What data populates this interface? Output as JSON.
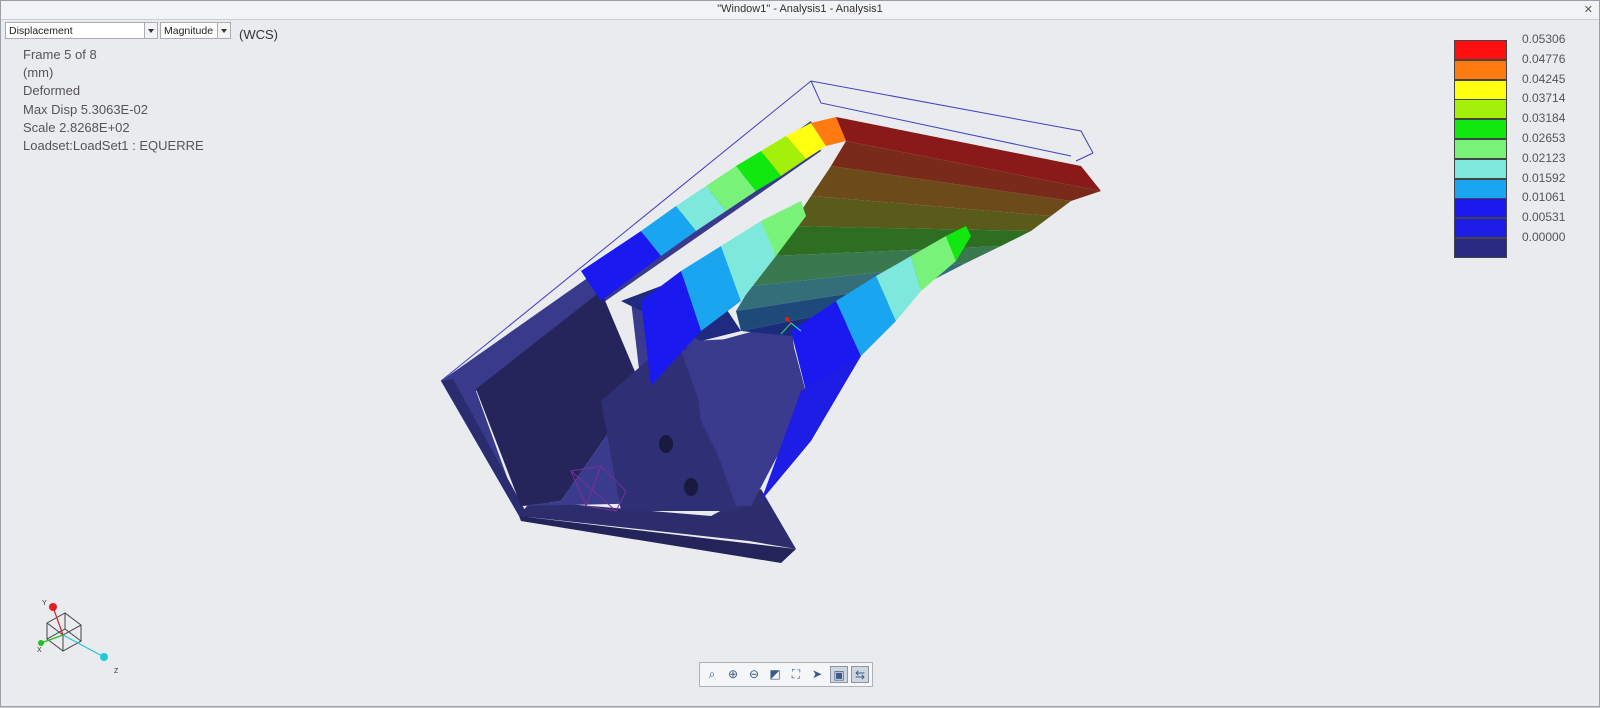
{
  "window": {
    "title": "\"Window1\" - Analysis1 - Analysis1"
  },
  "controls": {
    "result_type": "Displacement",
    "component": "Magnitude",
    "coordinate_system": "(WCS)"
  },
  "info": {
    "frame": "Frame 5 of 8",
    "units": "(mm)",
    "mode": "Deformed",
    "max_disp": "Max Disp  5.3063E-02",
    "scale": "Scale  2.8268E+02",
    "loadset": "Loadset:LoadSet1 :  EQUERRE"
  },
  "legend": {
    "values": [
      "0.05306",
      "0.04776",
      "0.04245",
      "0.03714",
      "0.03184",
      "0.02653",
      "0.02123",
      "0.01592",
      "0.01061",
      "0.00531",
      "0.00000"
    ],
    "colors": [
      "#ff1010",
      "#ff7a10",
      "#ffff10",
      "#a5f00a",
      "#10e810",
      "#79f279",
      "#7de8db",
      "#1aa5f0",
      "#1a1af0",
      "#1d1de6",
      "#2a2a82"
    ]
  },
  "toolbar": {
    "icons": [
      "refit-icon",
      "zoom-in-icon",
      "zoom-out-icon",
      "repaint-icon",
      "saved-views-icon",
      "spin-center-icon",
      "model-display-icon",
      "datum-display-icon"
    ]
  },
  "triad": {
    "labels": [
      "Y",
      "X",
      "Z"
    ]
  }
}
